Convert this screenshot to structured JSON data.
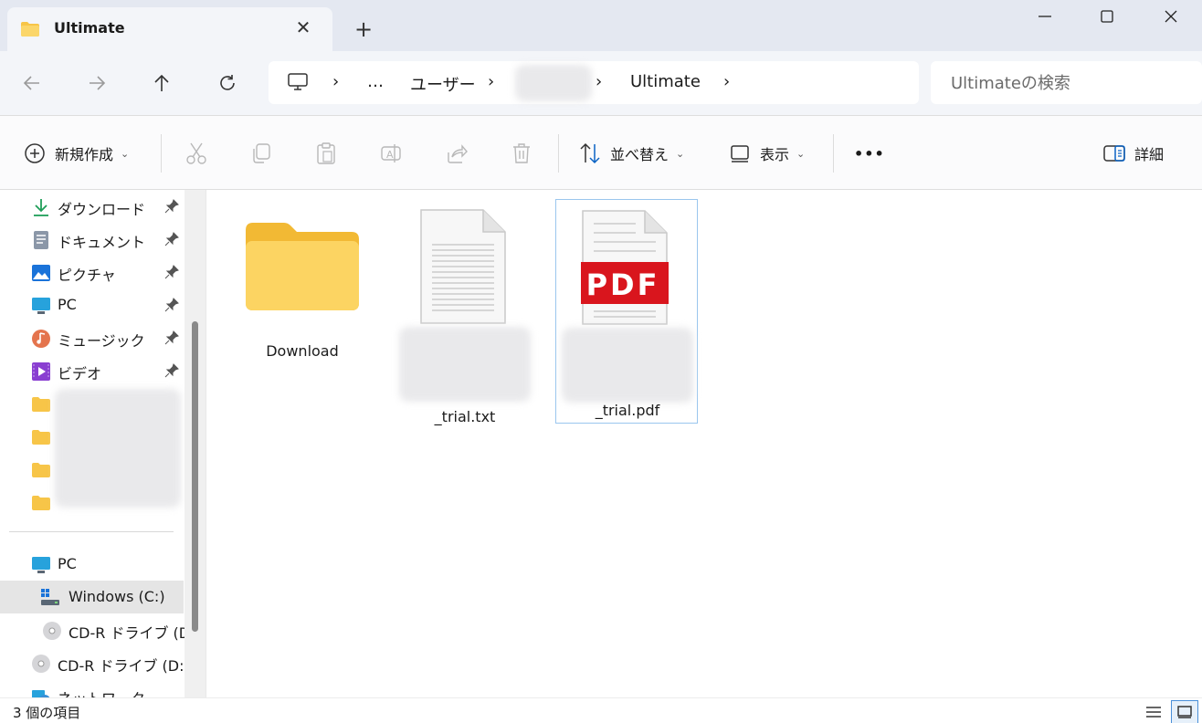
{
  "window": {
    "tab_title": "Ultimate",
    "new_tab_symbol": "+",
    "close_tab_symbol": "✕"
  },
  "address": {
    "crumbs": [
      "…",
      "ユーザー",
      "",
      "Ultimate"
    ],
    "search_placeholder": "Ultimateの検索"
  },
  "toolbar": {
    "new_label": "新規作成",
    "sort_label": "並べ替え",
    "view_label": "表示",
    "more_label": "•••",
    "details_label": "詳細"
  },
  "sidebar": {
    "quick_access": [
      {
        "label": "ダウンロード",
        "icon": "download-icon"
      },
      {
        "label": "ドキュメント",
        "icon": "document-icon"
      },
      {
        "label": "ピクチャ",
        "icon": "pictures-icon"
      },
      {
        "label": "PC",
        "icon": "pc-icon"
      },
      {
        "label": "ミュージック",
        "icon": "music-icon"
      },
      {
        "label": "ビデオ",
        "icon": "video-icon"
      }
    ],
    "pc_label": "PC",
    "drive_c_label": "Windows (C:)",
    "drive_d_sub_label": "CD-R ドライブ (D:",
    "drive_d_label": "CD-R ドライブ (D:)",
    "network_label": "ネットワーク"
  },
  "files": [
    {
      "name": "Download",
      "type": "folder"
    },
    {
      "name": "_trial.txt",
      "type": "text"
    },
    {
      "name": "_trial.pdf",
      "type": "pdf",
      "badge": "PDF"
    }
  ],
  "status": {
    "item_count": "3 個の項目"
  },
  "colors": {
    "folder": "#f7c548",
    "pdf_red": "#d9151d",
    "selection_border": "#9ac6ee"
  }
}
